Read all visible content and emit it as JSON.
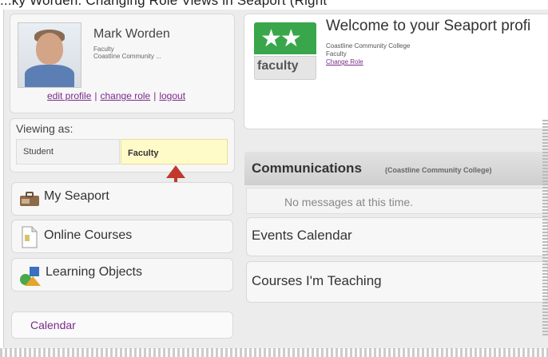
{
  "header_caption": "...ky Worden. Changing Role Views in Seaport (Right",
  "profile": {
    "name": "Mark Worden",
    "role": "Faculty",
    "org": "Coastline Community ...",
    "links": [
      "edit profile",
      "change role",
      "logout"
    ]
  },
  "viewing": {
    "label": "Viewing as:",
    "options": [
      "Student",
      "Faculty"
    ],
    "selected": "Faculty"
  },
  "nav": {
    "items": [
      {
        "label": "My Seaport",
        "icon": "briefcase-icon"
      },
      {
        "label": "Online Courses",
        "icon": "document-icon"
      },
      {
        "label": "Learning Objects",
        "icon": "shapes-icon"
      }
    ],
    "calendar": "Calendar"
  },
  "welcome": {
    "badge_text": "faculty",
    "title": "Welcome to your Seaport profi",
    "org": "Coastline Community College",
    "role": "Faculty",
    "change_role": "Change Role"
  },
  "communications": {
    "title": "Communications",
    "subtitle": "(Coastline Community College)",
    "empty_message": "No messages at this time."
  },
  "panels": {
    "events": "Events Calendar",
    "teaching": "Courses I'm Teaching"
  },
  "colors": {
    "link": "#7a2b8c",
    "selected_role_bg": "#fffbc8",
    "arrow": "#c0392b",
    "badge_green": "#3aa64b"
  }
}
